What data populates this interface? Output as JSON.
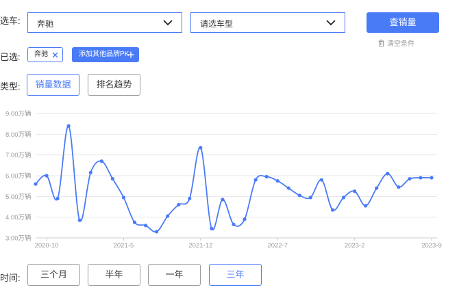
{
  "filters": {
    "car_label": "选车:",
    "brand_select_value": "奔驰",
    "model_select_placeholder": "请选车型",
    "query_button": "查销量",
    "clear_label": "清空条件"
  },
  "selected": {
    "label": "已选:",
    "tags": [
      "奔驰"
    ],
    "add_brand_button": "添加其他品牌PK"
  },
  "type_row": {
    "label": "类型:",
    "tabs": [
      "销量数据",
      "排名趋势"
    ],
    "active_tab": "销量数据"
  },
  "time_row": {
    "label": "时间:",
    "buttons": [
      "三个月",
      "半年",
      "一年",
      "三年"
    ],
    "active": "三年"
  },
  "colors": {
    "accent": "#4a7bf7",
    "grid": "#e5e5e5",
    "axis_text": "#999999"
  },
  "icons": [
    "chevron-down-icon",
    "trash-icon",
    "close-icon",
    "plus-icon"
  ],
  "chart_data": {
    "type": "line",
    "ylim": [
      3.0,
      9.0
    ],
    "y_ticks": [
      "3.00万辆",
      "4.00万辆",
      "5.00万辆",
      "6.00万辆",
      "7.00万辆",
      "8.00万辆",
      "9.00万辆"
    ],
    "x_tick_labels": [
      "2020-10",
      "2021-5",
      "2021-12",
      "2022-7",
      "2023-2",
      "2023-9"
    ],
    "grid": true,
    "series": [
      {
        "x": [
          "2020-9",
          "2020-10",
          "2020-11",
          "2020-12",
          "2021-1",
          "2021-2",
          "2021-3",
          "2021-4",
          "2021-5",
          "2021-6",
          "2021-7",
          "2021-8",
          "2021-9",
          "2021-10",
          "2021-11",
          "2021-12",
          "2022-1",
          "2022-2",
          "2022-3",
          "2022-4",
          "2022-5",
          "2022-6",
          "2022-7",
          "2022-8",
          "2022-9",
          "2022-10",
          "2022-11",
          "2022-12",
          "2023-1",
          "2023-2",
          "2023-3",
          "2023-4",
          "2023-5",
          "2023-6",
          "2023-7",
          "2023-8",
          "2023-9"
        ],
        "values": [
          5.6,
          6.0,
          4.9,
          8.4,
          3.85,
          6.15,
          6.7,
          5.85,
          4.95,
          3.75,
          3.6,
          3.3,
          4.05,
          4.6,
          4.9,
          7.35,
          3.45,
          4.85,
          3.65,
          3.9,
          5.8,
          5.95,
          5.75,
          5.4,
          5.05,
          4.95,
          5.8,
          4.35,
          4.95,
          5.25,
          4.55,
          5.4,
          6.1,
          5.45,
          5.85,
          5.9,
          5.9
        ]
      }
    ]
  }
}
